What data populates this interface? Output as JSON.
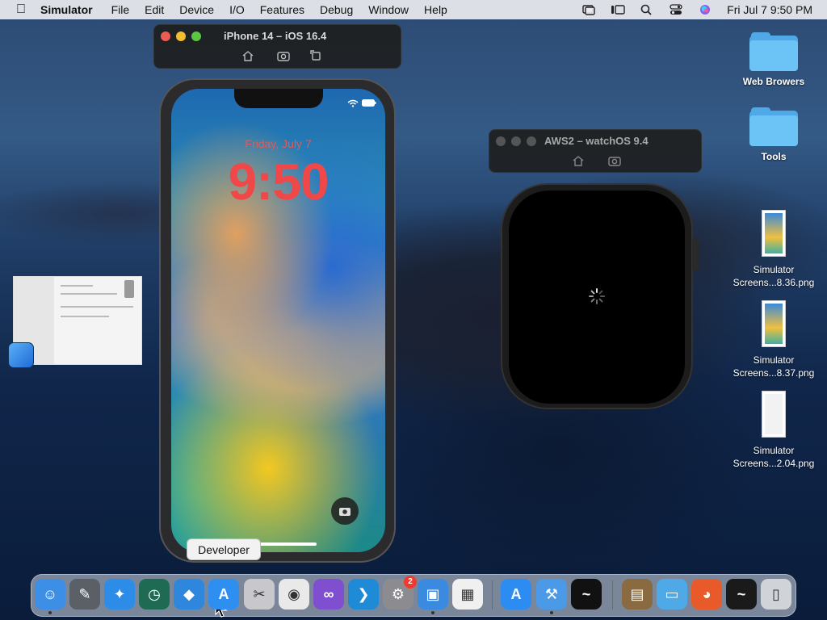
{
  "menubar": {
    "app_name": "Simulator",
    "menus": [
      "File",
      "Edit",
      "Device",
      "I/O",
      "Features",
      "Debug",
      "Window",
      "Help"
    ],
    "clock": "Fri Jul 7  9:50 PM"
  },
  "iphone_window": {
    "title": "iPhone 14 – iOS 16.4",
    "lock_date": "Friday, July 7",
    "lock_time": "9:50"
  },
  "watch_window": {
    "title": "AWS2 – watchOS 9.4"
  },
  "desktop_items": [
    {
      "type": "folder",
      "label": "Web Browers"
    },
    {
      "type": "folder",
      "label": "Tools"
    },
    {
      "type": "screenshot",
      "line1": "Simulator",
      "line2": "Screens...8.36.png"
    },
    {
      "type": "screenshot",
      "line1": "Simulator",
      "line2": "Screens...8.37.png"
    },
    {
      "type": "screenshot",
      "line1": "Simulator",
      "line2": "Screens...2.04.png"
    }
  ],
  "tooltip": "Developer",
  "dock": {
    "badge_count": "2",
    "apps": [
      {
        "name": "finder-icon",
        "color": "#3d8fe6",
        "glyph": "☺"
      },
      {
        "name": "xcode-instruments-icon",
        "color": "#5b5f66",
        "glyph": "✎"
      },
      {
        "name": "safari-icon",
        "color": "#2d8ce8",
        "glyph": "✦"
      },
      {
        "name": "time-machine-icon",
        "color": "#1e6a52",
        "glyph": "◷"
      },
      {
        "name": "network-icon",
        "color": "#2f86dd",
        "glyph": "◆"
      },
      {
        "name": "developer-icon",
        "color": "#2f8ff0",
        "glyph": "A"
      },
      {
        "name": "system-utility-icon",
        "color": "#c8c8cc",
        "glyph": "✂"
      },
      {
        "name": "chrome-icon",
        "color": "#e9e9e9",
        "glyph": "◉"
      },
      {
        "name": "visual-studio-icon",
        "color": "#7f4fd0",
        "glyph": "∞"
      },
      {
        "name": "vscode-icon",
        "color": "#1f8ad6",
        "glyph": "❯"
      },
      {
        "name": "system-settings-icon",
        "color": "#8c8c90",
        "glyph": "⚙"
      },
      {
        "name": "simulator-icon",
        "color": "#3a8ae0",
        "glyph": "▣"
      },
      {
        "name": "launchpad-icon",
        "color": "#f0f0f0",
        "glyph": "▦"
      },
      {
        "name": "app-store-icon",
        "color": "#2c8cf2",
        "glyph": "A"
      },
      {
        "name": "xcode-icon",
        "color": "#4a9ae8",
        "glyph": "⚒"
      },
      {
        "name": "activity-monitor-icon",
        "color": "#111111",
        "glyph": "~"
      },
      {
        "name": "archive-utility-icon",
        "color": "#8a6a40",
        "glyph": "▤"
      },
      {
        "name": "folder-icon",
        "color": "#4ea9e6",
        "glyph": "▭"
      },
      {
        "name": "firefox-icon",
        "color": "#e85a2a",
        "glyph": "◕"
      },
      {
        "name": "activity-monitor-icon",
        "color": "#1a1a1a",
        "glyph": "~"
      },
      {
        "name": "trash-icon",
        "color": "#d0d4d8",
        "glyph": "▯"
      }
    ]
  }
}
